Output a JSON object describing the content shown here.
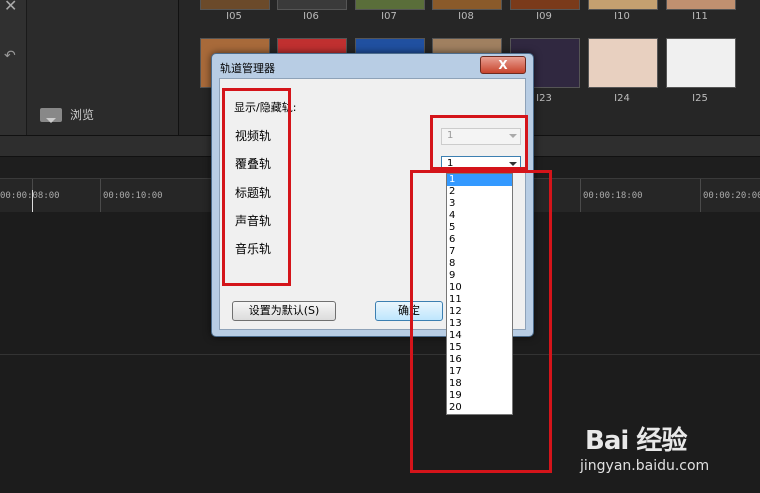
{
  "library": {
    "top_row": [
      "I05",
      "I06",
      "I07",
      "I08",
      "I09",
      "I10",
      "I11"
    ],
    "bottom_row": [
      "I23",
      "I24",
      "I25"
    ],
    "thumb_colors": {
      "row1": [
        "#6b4a2a",
        "#3a3a3a",
        "#5a6e3a",
        "#8a5a2a",
        "#7a3a1a",
        "#c4a070",
        "#c09070"
      ],
      "row2": [
        "#a86a3a",
        "#c03030",
        "#2050a0",
        "#a08060",
        "#302840",
        "#e8d0c0",
        "#f0f0f0"
      ]
    }
  },
  "sidebar": {
    "browse_label": "浏览"
  },
  "timeline": {
    "ruler_ticks": [
      "00:00:08:00",
      "00:00:10:00",
      "00:00:18:00",
      "00:00:20:00"
    ]
  },
  "dialog": {
    "title": "轨道管理器",
    "close_label": "X",
    "group_label": "显示/隐藏轨:",
    "tracks": [
      "视频轨",
      "覆叠轨",
      "标题轨",
      "声音轨",
      "音乐轨"
    ],
    "video_value": "1",
    "overlay_value": "1",
    "default_button": "设置为默认(S)",
    "ok_button": "确定"
  },
  "dropdown": {
    "options": [
      "1",
      "2",
      "3",
      "4",
      "5",
      "6",
      "7",
      "8",
      "9",
      "10",
      "11",
      "12",
      "13",
      "14",
      "15",
      "16",
      "17",
      "18",
      "19",
      "20"
    ],
    "selected": "1"
  },
  "watermark": {
    "logo": "Bai 经验",
    "url": "jingyan.baidu.com"
  },
  "colors": {
    "annotation_red": "#d4141a",
    "selection_blue": "#3399ff"
  }
}
